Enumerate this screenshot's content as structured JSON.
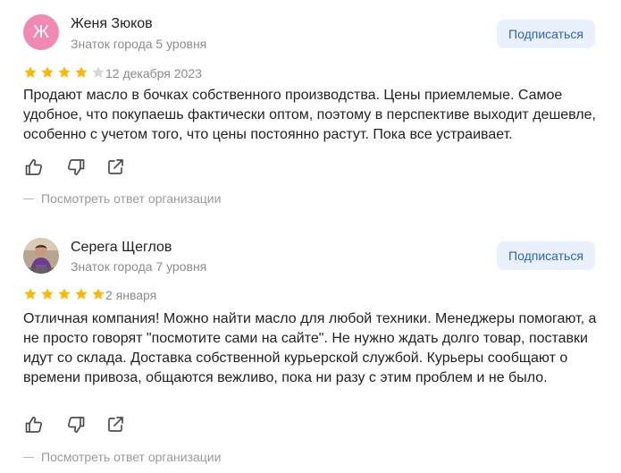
{
  "reviews": [
    {
      "author": {
        "name": "Женя Зюков",
        "level": "Знаток города 5 уровня",
        "avatar_letter": "Ж",
        "avatar_color": "#f18ab3"
      },
      "subscribe_label": "Подписаться",
      "rating": 4,
      "date": "12 декабря 2023",
      "text": "Продают масло в бочках собственного производства. Цены приемлемые. Самое удобное, что покупаешь фактически оптом, поэтому в перспективе выходит дешевле, особенно с учетом того, что цены постоянно растут. Пока все устраивает.",
      "actions": [
        "like-icon",
        "dislike-icon",
        "share-icon"
      ],
      "org_reply_label": "Посмотреть ответ организации"
    },
    {
      "author": {
        "name": "Серега Щеглов",
        "level": "Знаток города 7 уровня",
        "avatar_letter": "",
        "avatar_color": "#8c7a6b"
      },
      "subscribe_label": "Подписаться",
      "rating": 5,
      "date": "2 января",
      "text": "Отличная компания! Можно найти масло для любой техники. Менеджеры помогают, а не просто говорят \"посмотите сами на сайте\". Не нужно ждать долго товар, поставки идут со склада. Доставка собственной курьерской службой. Курьеры сообщают о времени привоза, общаются вежливо, пока ни разу с этим проблем и не было.",
      "actions": [
        "like-icon",
        "dislike-icon",
        "share-icon"
      ],
      "org_reply_label": "Посмотреть ответ организации"
    }
  ],
  "colors": {
    "star_filled": "#fcb900",
    "star_empty": "#d6d6d6",
    "accent": "#2963d1",
    "subscribe_bg": "#eaf1fc",
    "secondary_text": "#8c8c8c"
  }
}
